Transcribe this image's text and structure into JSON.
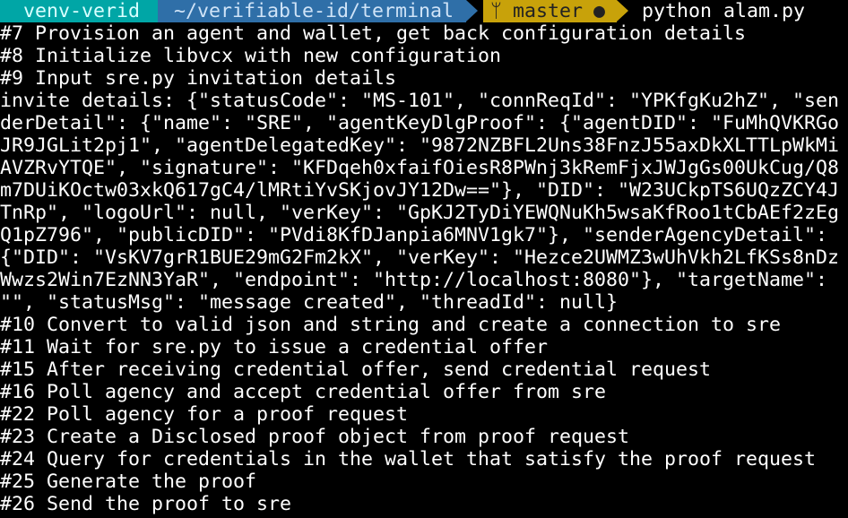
{
  "prompt": {
    "venv": "venv-verid",
    "path": "~/verifiable-id/terminal",
    "branch_icon": "git-branch-icon",
    "branch_glyph": "ᛘ",
    "branch": "master",
    "dirty_glyph": "●",
    "command": "python alam.py"
  },
  "colors": {
    "venv_bg": "#00a6a6",
    "path_bg": "#2f6fa8",
    "git_bg": "#c8a20a",
    "terminal_bg": "#000000",
    "text": "#ffffff"
  },
  "lines": [
    "#7 Provision an agent and wallet, get back configuration details",
    "#8 Initialize libvcx with new configuration",
    "#9 Input sre.py invitation details",
    "invite details: {\"statusCode\": \"MS-101\", \"connReqId\": \"YPKfgKu2hZ\", \"sen",
    "derDetail\": {\"name\": \"SRE\", \"agentKeyDlgProof\": {\"agentDID\": \"FuMhQVKRGo",
    "JR9JGLit2pj1\", \"agentDelegatedKey\": \"9872NZBFL2Uns38FnzJ55axDkXLTTLpWkMi",
    "AVZRvYTQE\", \"signature\": \"KFDqeh0xfaifOiesR8PWnj3kRemFjxJWJgGs00UkCug/Q8",
    "m7DUiKOctw03xkQ617gC4/lMRtiYvSKjovJY12Dw==\"}, \"DID\": \"W23UCkpTS6UQzZCY4J",
    "TnRp\", \"logoUrl\": null, \"verKey\": \"GpKJ2TyDiYEWQNuKh5wsaKfRoo1tCbAEf2zEg",
    "Q1pZ796\", \"publicDID\": \"PVdi8KfDJanpia6MNV1gk7\"}, \"senderAgencyDetail\":",
    "{\"DID\": \"VsKV7grR1BUE29mG2Fm2kX\", \"verKey\": \"Hezce2UWMZ3wUhVkh2LfKSs8nDz",
    "Wwzs2Win7EzNN3YaR\", \"endpoint\": \"http://localhost:8080\"}, \"targetName\":",
    "\"\", \"statusMsg\": \"message created\", \"threadId\": null}",
    "#10 Convert to valid json and string and create a connection to sre",
    "#11 Wait for sre.py to issue a credential offer",
    "#15 After receiving credential offer, send credential request",
    "#16 Poll agency and accept credential offer from sre",
    "#22 Poll agency for a proof request",
    "#23 Create a Disclosed proof object from proof request",
    "#24 Query for credentials in the wallet that satisfy the proof request",
    "#25 Generate the proof",
    "#26 Send the proof to sre"
  ]
}
